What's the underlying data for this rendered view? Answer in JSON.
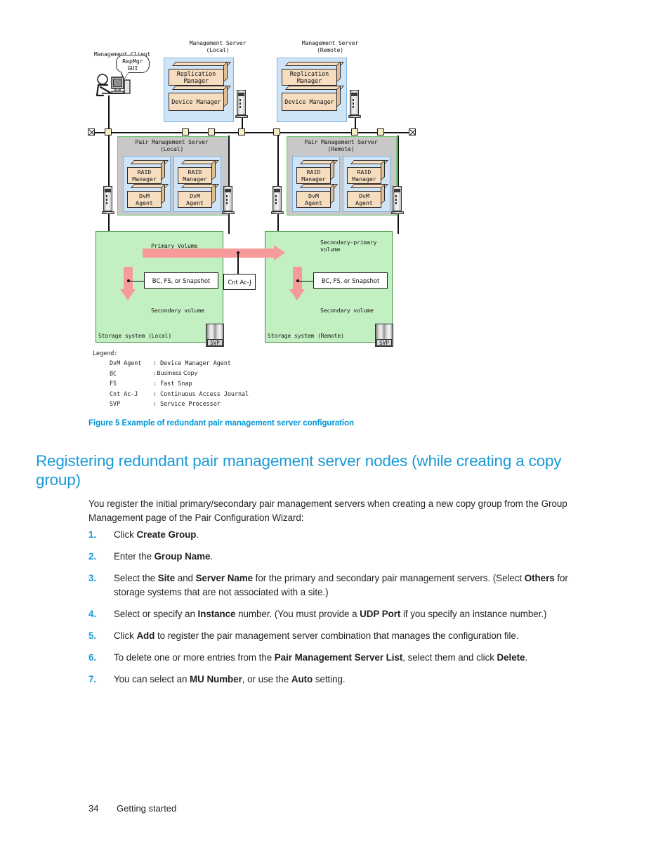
{
  "figure": {
    "caption": "Figure 5 Example of redundant pair management server configuration",
    "labels": {
      "management_client": "Management Client",
      "bubble": "RepMgr\nGUI",
      "ms_local": "Management Server\n(Local)",
      "ms_remote": "Management Server\n(Remote)",
      "replication_manager": "Replication\nManager",
      "device_manager": "Device Manager",
      "pms_local": "Pair Management Server\n(Local)",
      "pms_remote": "Pair Management Server\n(Remote)",
      "raid_manager": "RAID\nManager",
      "dvm_agent": "DvM\nAgent",
      "primary_volume": "Primary Volume",
      "secondary_primary_volume": "Secondary-primary\nvolume",
      "secondary_volume": "Secondary volume",
      "bc_fs_snapshot": "BC, FS, or Snapshot",
      "cnt_ac_j": "Cnt Ac-J",
      "storage_local": "Storage system (Local)",
      "storage_remote": "Storage system (Remote)",
      "svp": "SVP"
    },
    "legend": {
      "title": "Legend:",
      "entries": [
        {
          "term": "DvM Agent",
          "def": ": Device Manager Agent"
        },
        {
          "term": "BC",
          "def": ": Business Copy"
        },
        {
          "term": "FS",
          "def": ": Fast Snap"
        },
        {
          "term": "Cnt Ac-J",
          "def": ": Continuous Access Journal"
        },
        {
          "term": "SVP",
          "def": ": Service Processor"
        }
      ]
    }
  },
  "heading": "Registering redundant pair management server nodes (while creating a copy group)",
  "intro": "You register the initial primary/secondary pair management servers when creating a new copy group from the Group Management page of the Pair Configuration Wizard:",
  "steps": [
    {
      "num": "1.",
      "html": "Click <b>Create Group</b>."
    },
    {
      "num": "2.",
      "html": "Enter the <b>Group Name</b>."
    },
    {
      "num": "3.",
      "html": "Select the <b>Site</b> and <b>Server Name</b> for the primary and secondary pair management servers. (Select <b>Others</b> for storage systems that are not associated with a site.)"
    },
    {
      "num": "4.",
      "html": "Select or specify an <b>Instance</b> number. (You must provide a <b>UDP Port</b> if you specify an instance number.)"
    },
    {
      "num": "5.",
      "html": "Click <b>Add</b> to register the pair management server combination that manages the configuration file."
    },
    {
      "num": "6.",
      "html": "To delete one or more entries from the <b>Pair Management Server List</b>, select them and click <b>Delete</b>."
    },
    {
      "num": "7.",
      "html": "You can select an <b>MU Number</b>, or use the <b>Auto</b> setting."
    }
  ],
  "footer": {
    "page_number": "34",
    "section": "Getting started"
  },
  "colors": {
    "accent": "#0096d6",
    "heading": "#1b9ad6",
    "text": "#231f20",
    "panel_blue": "#cfe4f7",
    "panel_gray": "#c8c8c8",
    "panel_green": "#c3f0c3",
    "box_fill": "#f6ddc0",
    "arrow_pink": "#f79a9a"
  }
}
